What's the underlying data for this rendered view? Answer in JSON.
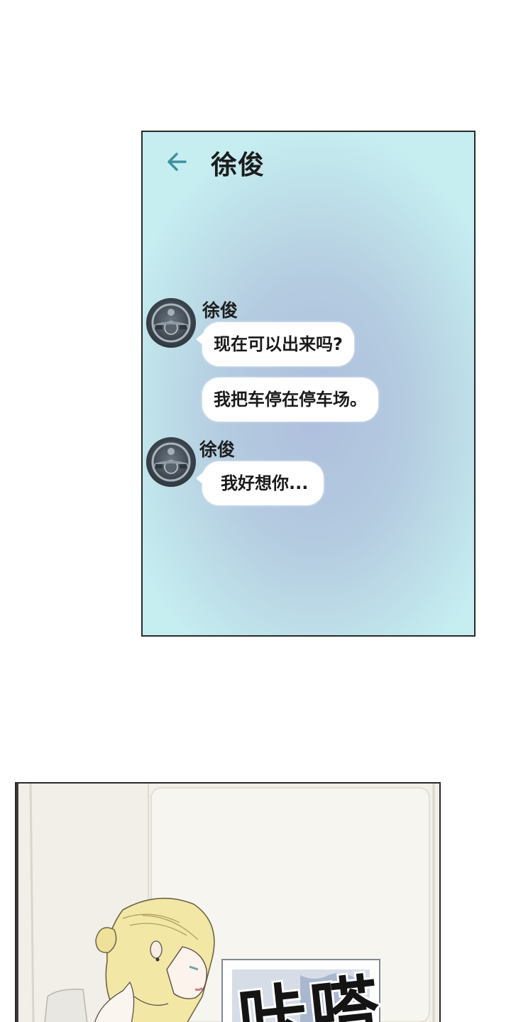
{
  "chat": {
    "title": "徐俊",
    "icons": {
      "back": "arrow-left-icon",
      "avatar": "steering-wheel-avatar"
    },
    "accent_color": "#3f8fa0",
    "messages": [
      {
        "sender": "徐俊",
        "text": "现在可以出来吗?"
      },
      {
        "text": "我把车停在停车场。"
      },
      {
        "sender": "徐俊",
        "text": "我好想你..."
      }
    ]
  },
  "comic": {
    "sfx": "咔嗒"
  }
}
